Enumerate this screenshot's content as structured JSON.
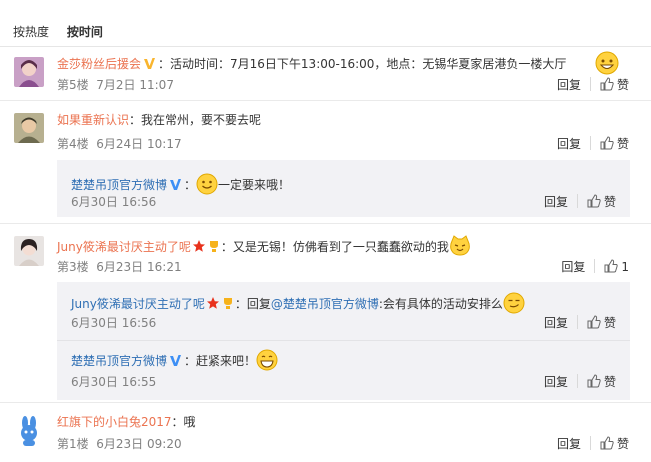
{
  "tabs": [
    {
      "label": "按热度"
    },
    {
      "label": "按时间"
    }
  ],
  "actions": {
    "reply": "回复",
    "like": "赞"
  },
  "comments": [
    {
      "username": "金莎粉丝后援会",
      "text": "：活动时间：7月16日下午13:00-16:00，地点：无锡华夏家居港负一楼大厅",
      "floor": "第5楼",
      "date": "7月2日 11:07",
      "likes": ""
    },
    {
      "username": "如果重新认识",
      "text": "：我在常州，要不要去呢",
      "floor": "第4楼",
      "date": "6月24日 10:17",
      "likes": "",
      "replies": [
        {
          "username": "楚楚吊顶官方微博",
          "text": "一定要来哦！",
          "date": "6月30日 16:56"
        }
      ]
    },
    {
      "username": "Juny筱浠最讨厌主动了呢",
      "text": "：又是无锡！仿佛看到了一只蠢蠢欲动的我",
      "floor": "第3楼",
      "date": "6月23日 16:21",
      "likes": "1",
      "replies": [
        {
          "username": "Juny筱浠最讨厌主动了呢",
          "text_prefix": "：回复",
          "mention": "@楚楚吊顶官方微博",
          "text": ":会有具体的活动安排么",
          "date": "6月30日 16:56"
        },
        {
          "username": "楚楚吊顶官方微博",
          "text": "：赶紧来吧！",
          "date": "6月30日 16:55"
        }
      ]
    },
    {
      "username": "红旗下的小白兔2017",
      "text": "：哦",
      "floor": "第1楼",
      "date": "6月23日 09:20",
      "likes": ""
    }
  ],
  "colors": {
    "username": "#eb7350",
    "link": "#2f6fb4",
    "meta": "#808080",
    "reply_bg": "#f2f2f5",
    "verified": "#f9b52e"
  }
}
